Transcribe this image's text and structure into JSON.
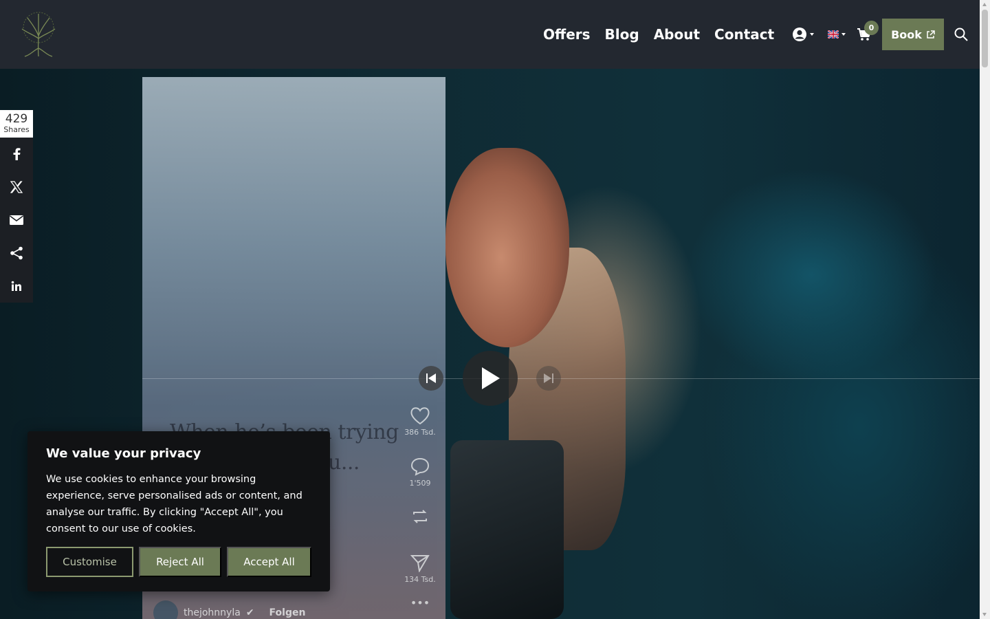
{
  "header": {
    "nav": [
      "Offers",
      "Blog",
      "About",
      "Contact"
    ],
    "cart_count": "0",
    "book_label": "Book"
  },
  "share": {
    "count": "429",
    "label": "Shares",
    "networks": [
      "facebook",
      "x",
      "email",
      "share",
      "linkedin"
    ]
  },
  "video": {
    "overlay_text_line1": "When he’s been trying",
    "overlay_text_line2": "u...",
    "likes": "386 Tsd.",
    "comments": "1'509",
    "shares": "134 Tsd.",
    "username": "thejohnnyla",
    "follow_label": "Folgen"
  },
  "cookie": {
    "title": "We value your privacy",
    "text": "We use cookies to enhance your browsing experience, serve personalised ads or content, and analyse our traffic. By clicking \"Accept All\", you consent to our use of cookies.",
    "customise_label": "Customise",
    "reject_label": "Reject All",
    "accept_label": "Accept All"
  },
  "colors": {
    "header_bg": "#232830",
    "accent_green": "#6b7a55",
    "cookie_bg": "#111214"
  }
}
